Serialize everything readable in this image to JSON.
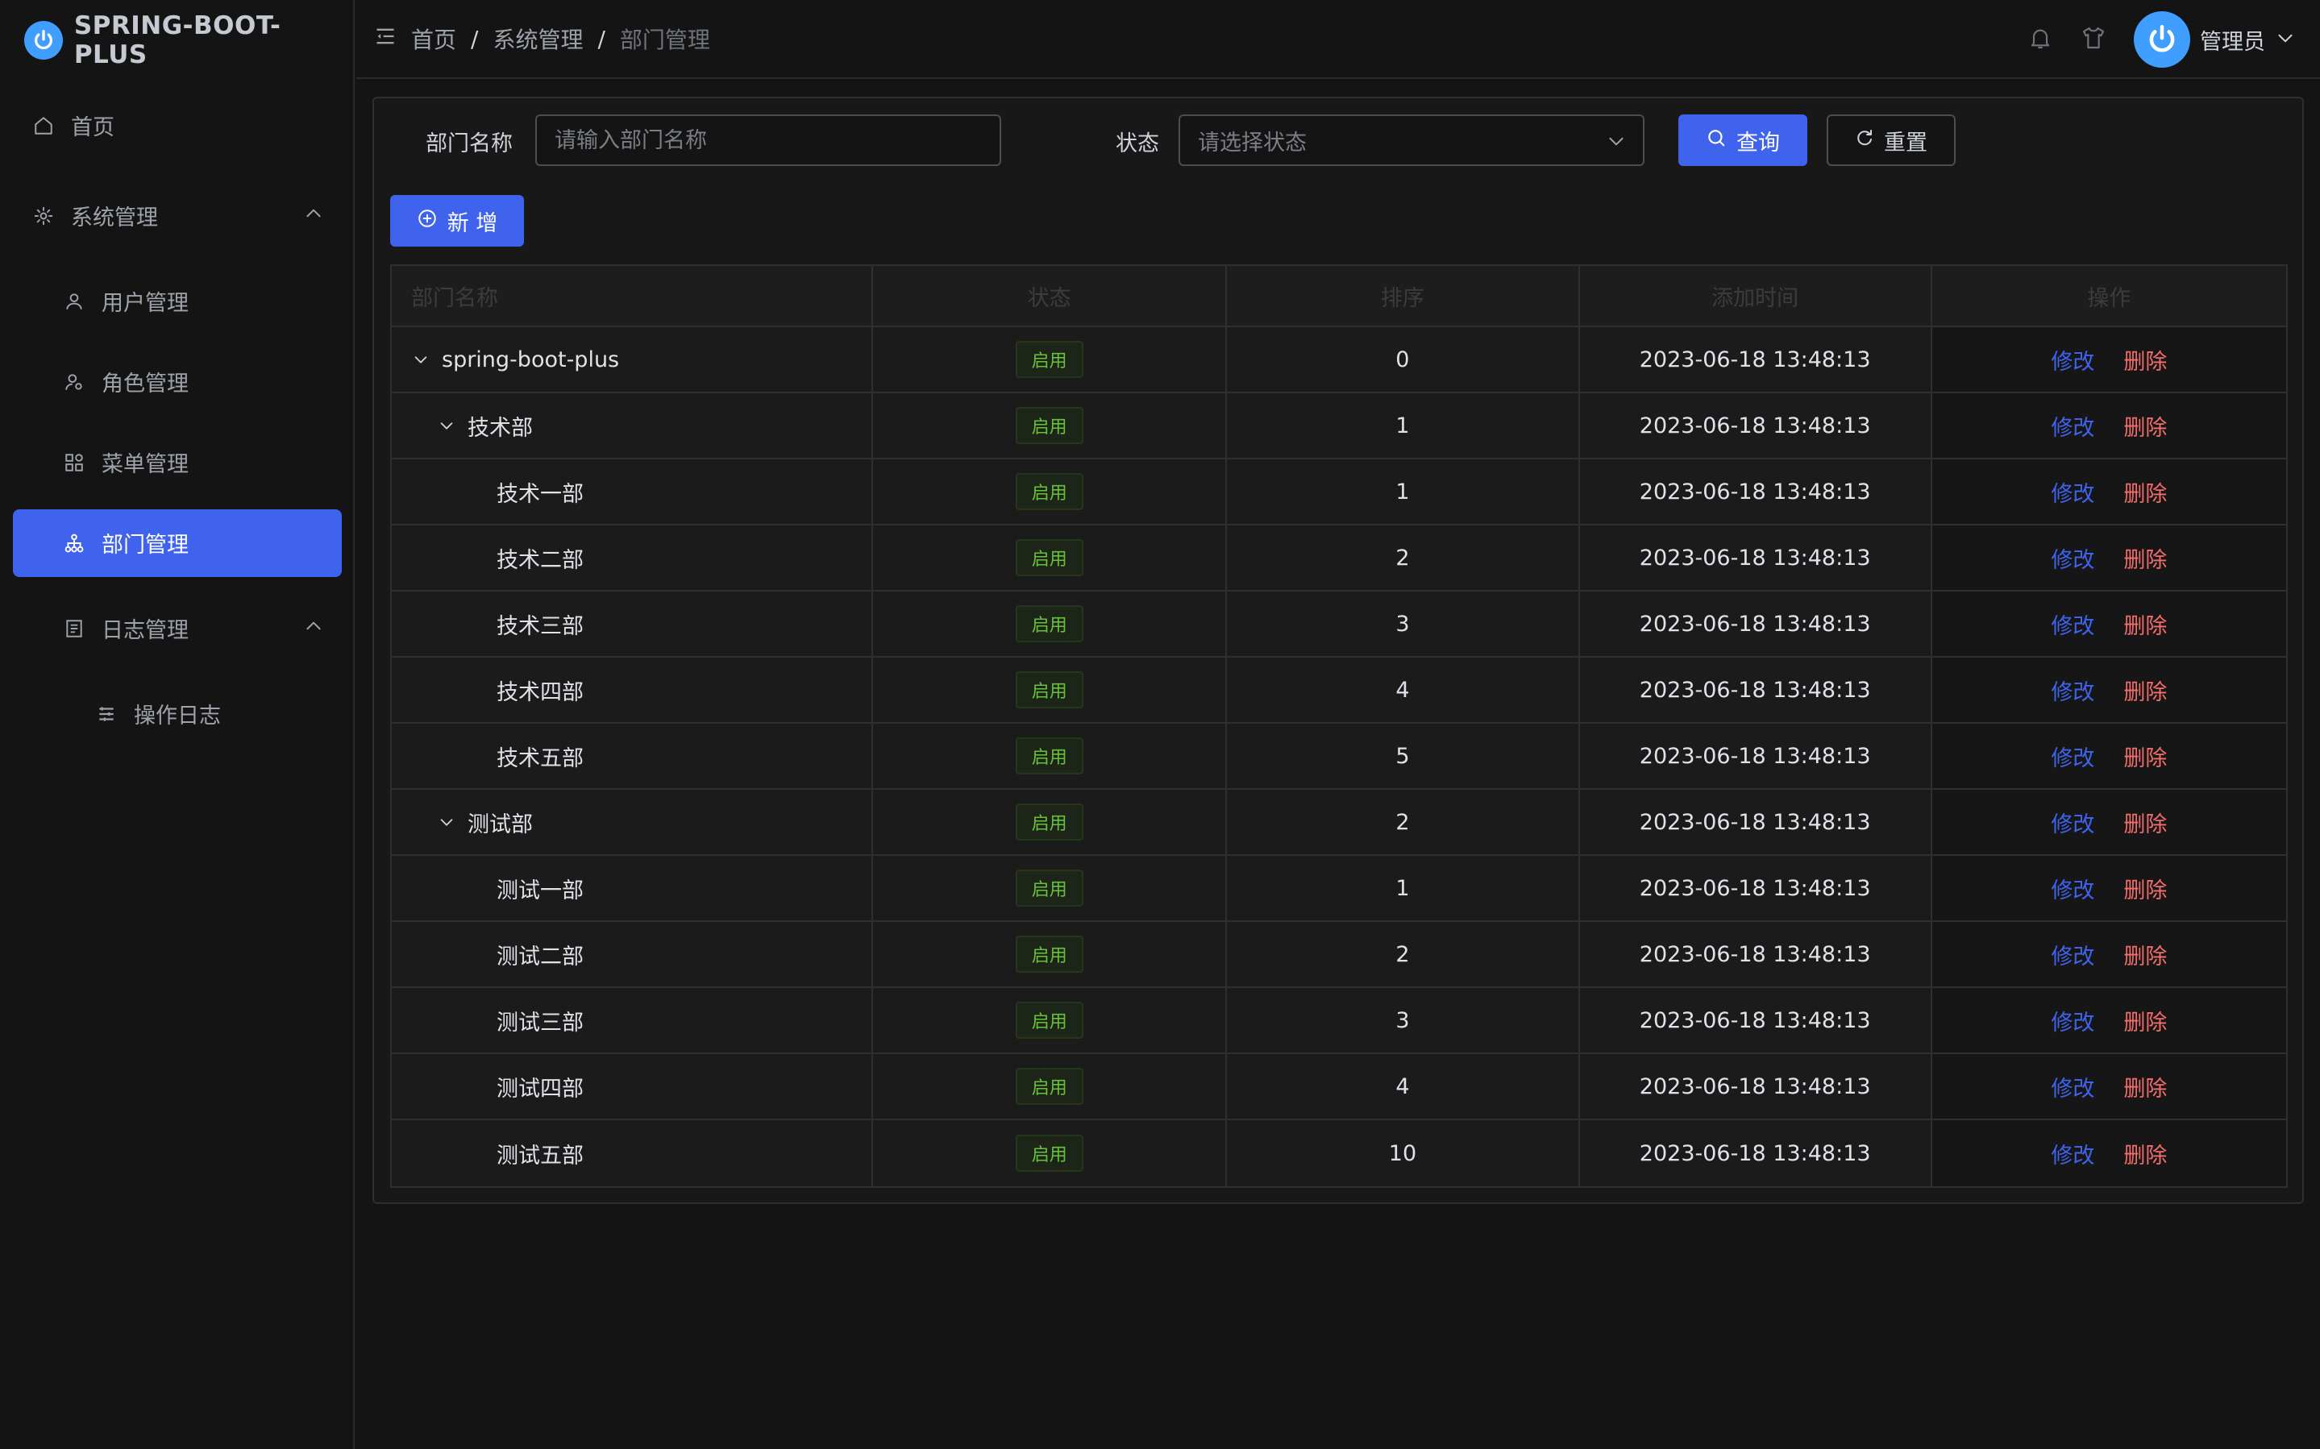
{
  "sidebar": {
    "logo_text": "SPRING-BOOT-PLUS",
    "items": [
      {
        "label": "首页",
        "icon": "home-icon"
      },
      {
        "label": "系统管理",
        "icon": "gear-icon"
      },
      {
        "label": "用户管理",
        "icon": "user-icon"
      },
      {
        "label": "角色管理",
        "icon": "role-icon"
      },
      {
        "label": "菜单管理",
        "icon": "grid-icon"
      },
      {
        "label": "部门管理",
        "icon": "org-icon"
      },
      {
        "label": "日志管理",
        "icon": "document-icon"
      },
      {
        "label": "操作日志",
        "icon": "list-icon"
      }
    ]
  },
  "header": {
    "breadcrumb": [
      "首页",
      "系统管理",
      "部门管理"
    ],
    "breadcrumb_sep": "/",
    "user_name": "管理员"
  },
  "filters": {
    "dept_label": "部门名称",
    "dept_placeholder": "请输入部门名称",
    "status_label": "状态",
    "status_placeholder": "请选择状态",
    "search_label": "查询",
    "reset_label": "重置",
    "add_label": "新 增"
  },
  "table": {
    "columns": [
      "部门名称",
      "状态",
      "排序",
      "添加时间",
      "操作"
    ],
    "edit_label": "修改",
    "delete_label": "删除",
    "rows": [
      {
        "name": "spring-boot-plus",
        "status": "启用",
        "sort": "0",
        "time": "2023-06-18 13:48:13",
        "level": 0,
        "expanded": true
      },
      {
        "name": "技术部",
        "status": "启用",
        "sort": "1",
        "time": "2023-06-18 13:48:13",
        "level": 1,
        "expanded": true
      },
      {
        "name": "技术一部",
        "status": "启用",
        "sort": "1",
        "time": "2023-06-18 13:48:13",
        "level": 2
      },
      {
        "name": "技术二部",
        "status": "启用",
        "sort": "2",
        "time": "2023-06-18 13:48:13",
        "level": 2
      },
      {
        "name": "技术三部",
        "status": "启用",
        "sort": "3",
        "time": "2023-06-18 13:48:13",
        "level": 2
      },
      {
        "name": "技术四部",
        "status": "启用",
        "sort": "4",
        "time": "2023-06-18 13:48:13",
        "level": 2
      },
      {
        "name": "技术五部",
        "status": "启用",
        "sort": "5",
        "time": "2023-06-18 13:48:13",
        "level": 2
      },
      {
        "name": "测试部",
        "status": "启用",
        "sort": "2",
        "time": "2023-06-18 13:48:13",
        "level": 1,
        "expanded": true
      },
      {
        "name": "测试一部",
        "status": "启用",
        "sort": "1",
        "time": "2023-06-18 13:48:13",
        "level": 2
      },
      {
        "name": "测试二部",
        "status": "启用",
        "sort": "2",
        "time": "2023-06-18 13:48:13",
        "level": 2
      },
      {
        "name": "测试三部",
        "status": "启用",
        "sort": "3",
        "time": "2023-06-18 13:48:13",
        "level": 2
      },
      {
        "name": "测试四部",
        "status": "启用",
        "sort": "4",
        "time": "2023-06-18 13:48:13",
        "level": 2
      },
      {
        "name": "测试五部",
        "status": "启用",
        "sort": "10",
        "time": "2023-06-18 13:48:13",
        "level": 2
      }
    ]
  },
  "colors": {
    "primary": "#3f63ec",
    "success": "#67c23a",
    "danger": "#f56c6c",
    "background": "#141414"
  }
}
